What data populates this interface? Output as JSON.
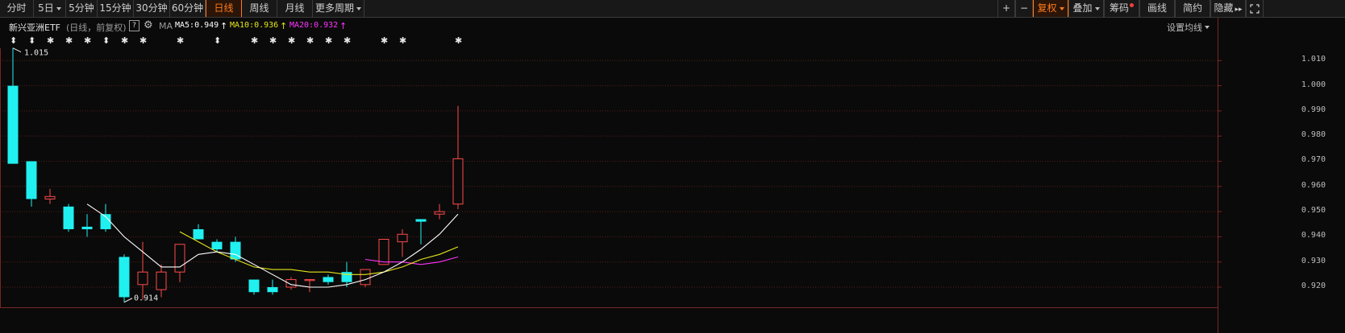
{
  "toolbar": {
    "left": [
      {
        "label": "分时"
      },
      {
        "label": "5日",
        "dropdown": true
      },
      {
        "label": "5分钟"
      },
      {
        "label": "15分钟"
      },
      {
        "label": "30分钟"
      },
      {
        "label": "60分钟"
      },
      {
        "label": "日线",
        "active": true
      },
      {
        "label": "周线"
      },
      {
        "label": "月线"
      },
      {
        "label": "更多周期",
        "dropdown": true
      }
    ],
    "right": [
      {
        "label": "+",
        "name": "zoom-in-button"
      },
      {
        "label": "−",
        "name": "zoom-out-button"
      },
      {
        "label": "复权",
        "dropdown": true,
        "active": true,
        "name": "adjust-button"
      },
      {
        "label": "叠加",
        "dropdown": true,
        "name": "overlay-button"
      },
      {
        "label": "筹码",
        "dot": true,
        "name": "chips-button"
      },
      {
        "label": "画线",
        "name": "draw-line-button"
      },
      {
        "label": "简约",
        "name": "simple-button"
      },
      {
        "label": "隐藏",
        "name": "hide-button"
      }
    ]
  },
  "legend": {
    "name": "新兴亚洲ETF",
    "mode": "(日线，前复权)",
    "ma_label": "MA",
    "ma5": "MA5:0.949",
    "ma10": "MA10:0.936",
    "ma20": "MA20:0.932",
    "settings": "设置均线",
    "colors": {
      "ma5": "#ffffff",
      "ma10": "#e5e51a",
      "ma20": "#ff33ff"
    }
  },
  "marks": [
    "⬍",
    "⬍",
    "✱",
    "✱",
    "✱",
    "⬍",
    "✱",
    "✱",
    "✱",
    "⬍",
    "✱",
    "✱",
    "✱",
    "✱",
    "✱",
    "✱",
    "✱",
    "✱",
    "✱"
  ],
  "chart_data": {
    "type": "candlestick",
    "ylim": [
      0.912,
      1.02
    ],
    "ticks": [
      0.92,
      0.93,
      0.94,
      0.95,
      0.96,
      0.97,
      0.98,
      0.99,
      1.0,
      1.01
    ],
    "tick_labels": [
      "0.920",
      "0.930",
      "0.940",
      "0.950",
      "0.960",
      "0.970",
      "0.980",
      "0.990",
      "1.000",
      "1.010"
    ],
    "high_label": "1.015",
    "low_label": "0.914",
    "colors": {
      "up": "#ff4a4a",
      "down": "#20f0f0"
    },
    "candles": [
      {
        "o": 1.0,
        "h": 1.015,
        "l": 0.969,
        "c": 0.969
      },
      {
        "o": 0.97,
        "h": 0.97,
        "l": 0.952,
        "c": 0.955
      },
      {
        "o": 0.955,
        "h": 0.959,
        "l": 0.953,
        "c": 0.956
      },
      {
        "o": 0.952,
        "h": 0.953,
        "l": 0.942,
        "c": 0.943
      },
      {
        "o": 0.944,
        "h": 0.949,
        "l": 0.94,
        "c": 0.943
      },
      {
        "o": 0.949,
        "h": 0.953,
        "l": 0.942,
        "c": 0.943
      },
      {
        "o": 0.932,
        "h": 0.933,
        "l": 0.914,
        "c": 0.916
      },
      {
        "o": 0.921,
        "h": 0.938,
        "l": 0.915,
        "c": 0.926
      },
      {
        "o": 0.919,
        "h": 0.929,
        "l": 0.916,
        "c": 0.926
      },
      {
        "o": 0.926,
        "h": 0.937,
        "l": 0.922,
        "c": 0.937
      },
      {
        "o": 0.943,
        "h": 0.945,
        "l": 0.939,
        "c": 0.939
      },
      {
        "o": 0.938,
        "h": 0.939,
        "l": 0.934,
        "c": 0.935
      },
      {
        "o": 0.938,
        "h": 0.94,
        "l": 0.93,
        "c": 0.931
      },
      {
        "o": 0.923,
        "h": 0.923,
        "l": 0.917,
        "c": 0.918
      },
      {
        "o": 0.92,
        "h": 0.923,
        "l": 0.917,
        "c": 0.918
      },
      {
        "o": 0.92,
        "h": 0.924,
        "l": 0.919,
        "c": 0.923
      },
      {
        "o": 0.923,
        "h": 0.923,
        "l": 0.918,
        "c": 0.923
      },
      {
        "o": 0.924,
        "h": 0.925,
        "l": 0.921,
        "c": 0.922
      },
      {
        "o": 0.926,
        "h": 0.93,
        "l": 0.92,
        "c": 0.922
      },
      {
        "o": 0.921,
        "h": 0.927,
        "l": 0.92,
        "c": 0.927
      },
      {
        "o": 0.929,
        "h": 0.939,
        "l": 0.929,
        "c": 0.939
      },
      {
        "o": 0.938,
        "h": 0.943,
        "l": 0.932,
        "c": 0.941
      },
      {
        "o": 0.947,
        "h": 0.947,
        "l": 0.937,
        "c": 0.946
      },
      {
        "o": 0.949,
        "h": 0.953,
        "l": 0.947,
        "c": 0.95
      },
      {
        "o": 0.953,
        "h": 0.992,
        "l": 0.951,
        "c": 0.971
      }
    ],
    "ma5": [
      null,
      null,
      null,
      null,
      0.953,
      0.948,
      0.94,
      0.934,
      0.928,
      0.928,
      0.933,
      0.934,
      0.933,
      0.929,
      0.925,
      0.921,
      0.92,
      0.92,
      0.921,
      0.923,
      0.926,
      0.93,
      0.935,
      0.941,
      0.949
    ],
    "ma10": [
      null,
      null,
      null,
      null,
      null,
      null,
      null,
      null,
      null,
      0.942,
      0.938,
      0.934,
      0.931,
      0.928,
      0.927,
      0.927,
      0.926,
      0.926,
      0.925,
      0.925,
      0.926,
      0.928,
      0.931,
      0.933,
      0.936
    ],
    "ma20": [
      null,
      null,
      null,
      null,
      null,
      null,
      null,
      null,
      null,
      null,
      null,
      null,
      null,
      null,
      null,
      null,
      null,
      null,
      null,
      0.931,
      0.93,
      0.93,
      0.929,
      0.93,
      0.932
    ]
  }
}
